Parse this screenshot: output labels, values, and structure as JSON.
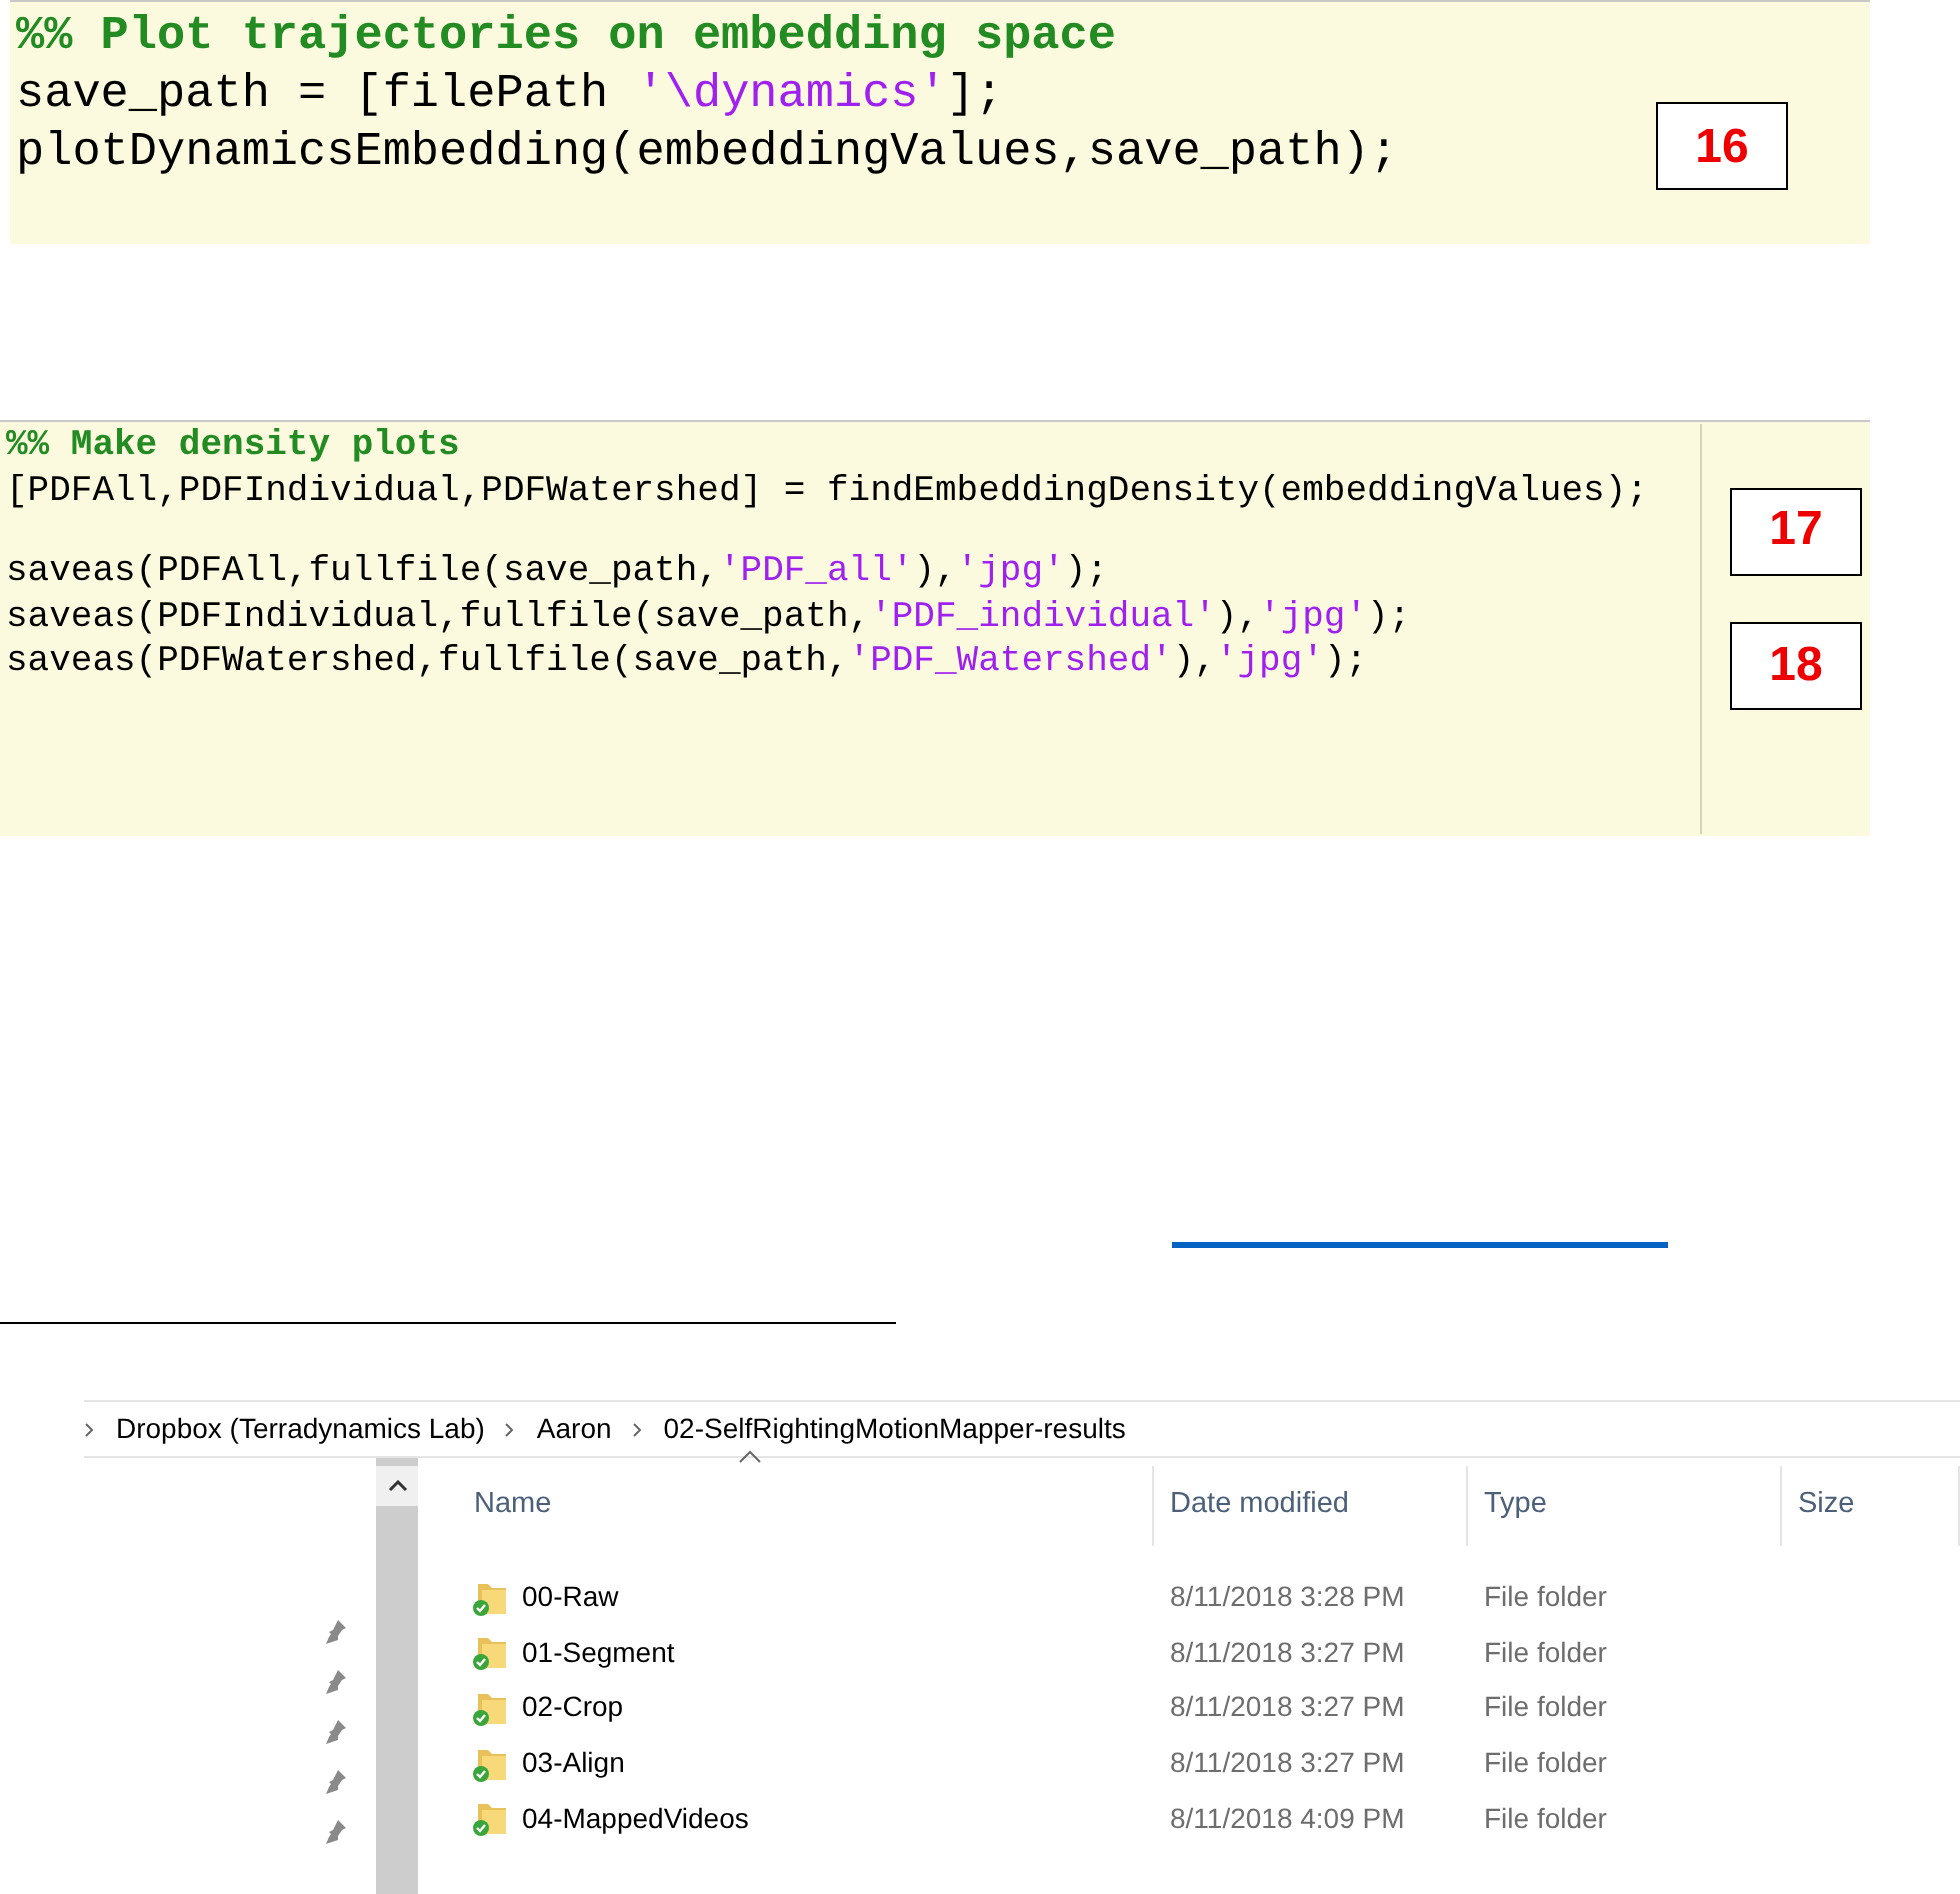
{
  "code_blocks": [
    {
      "lines": [
        {
          "kind": "code",
          "tokens": [
            {
              "kind": "comment",
              "text": "%% Plot trajectories on embedding space"
            }
          ]
        },
        {
          "kind": "code",
          "tokens": [
            {
              "kind": "plain",
              "text": "save_path = [filePath "
            },
            {
              "kind": "string",
              "text": "'\\dynamics'"
            },
            {
              "kind": "plain",
              "text": "];"
            }
          ]
        },
        {
          "kind": "code",
          "tokens": [
            {
              "kind": "plain",
              "text": "plotDynamicsEmbedding(embeddingValues,save_path);"
            }
          ]
        }
      ],
      "callouts": [
        {
          "text": "16"
        }
      ]
    },
    {
      "lines": [
        {
          "kind": "code",
          "tokens": [
            {
              "kind": "comment",
              "text": "%% Make density plots"
            }
          ]
        },
        {
          "kind": "code",
          "tokens": [
            {
              "kind": "plain",
              "text": "[PDFAll,PDFIndividual,PDFWatershed] = findEmbeddingDensity(embeddingValues);"
            }
          ]
        },
        {
          "kind": "blank"
        },
        {
          "kind": "code",
          "tokens": [
            {
              "kind": "plain",
              "text": "saveas(PDFAll,fullfile(save_path,"
            },
            {
              "kind": "string",
              "text": "'PDF_all'"
            },
            {
              "kind": "plain",
              "text": "),"
            },
            {
              "kind": "string",
              "text": "'jpg'"
            },
            {
              "kind": "plain",
              "text": ");"
            }
          ]
        },
        {
          "kind": "code",
          "tokens": [
            {
              "kind": "plain",
              "text": "saveas(PDFIndividual,fullfile(save_path,"
            },
            {
              "kind": "string",
              "text": "'PDF_individual'"
            },
            {
              "kind": "plain",
              "text": "),"
            },
            {
              "kind": "string",
              "text": "'jpg'"
            },
            {
              "kind": "plain",
              "text": ");"
            }
          ]
        },
        {
          "kind": "code",
          "tokens": [
            {
              "kind": "plain",
              "text": "saveas(PDFWatershed,fullfile(save_path,"
            },
            {
              "kind": "string",
              "text": "'PDF_Watershed'"
            },
            {
              "kind": "plain",
              "text": "),"
            },
            {
              "kind": "string",
              "text": "'jpg'"
            },
            {
              "kind": "plain",
              "text": ");"
            }
          ]
        },
        {
          "kind": "blank"
        }
      ],
      "callouts": [
        {
          "text": "17"
        },
        {
          "text": "18"
        }
      ]
    }
  ],
  "explorer": {
    "breadcrumb": [
      "Dropbox (Terradynamics Lab)",
      "Aaron",
      "02-SelfRightingMotionMapper-results"
    ],
    "columns": [
      {
        "label": "Name",
        "sorted": true
      },
      {
        "label": "Date modified",
        "sorted": false
      },
      {
        "label": "Type",
        "sorted": false
      },
      {
        "label": "Size",
        "sorted": false
      }
    ],
    "rows": [
      {
        "name": "00-Raw",
        "date": "8/11/2018 3:28 PM",
        "type": "File folder"
      },
      {
        "name": "01-Segment",
        "date": "8/11/2018 3:27 PM",
        "type": "File folder"
      },
      {
        "name": "02-Crop",
        "date": "8/11/2018 3:27 PM",
        "type": "File folder"
      },
      {
        "name": "03-Align",
        "date": "8/11/2018 3:27 PM",
        "type": "File folder"
      },
      {
        "name": "04-MappedVideos",
        "date": "8/11/2018 4:09 PM",
        "type": "File folder"
      }
    ]
  }
}
